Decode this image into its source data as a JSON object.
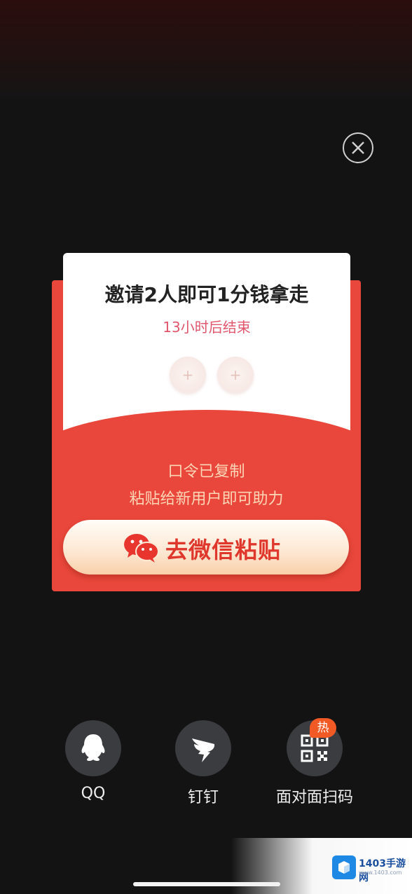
{
  "popup": {
    "title": "邀请2人即可1分钱拿走",
    "countdown": "13小时后结束",
    "slot_symbol": "+",
    "copied_text": "口令已复制",
    "paste_tip": "粘贴给新用户即可助力",
    "wechat_button": "去微信粘贴"
  },
  "share": {
    "items": [
      {
        "label": "QQ",
        "icon": "qq-icon"
      },
      {
        "label": "钉钉",
        "icon": "dingtalk-icon"
      },
      {
        "label": "面对面扫码",
        "icon": "qrcode-icon"
      }
    ],
    "hot_badge": "热"
  },
  "watermark": {
    "name": "1403手游网",
    "url": "www.1403.com"
  },
  "colors": {
    "card_red": "#e9473b",
    "countdown_pink": "#e0566c",
    "button_text": "#e0372c",
    "badge_orange": "#f15a24",
    "wechat_red": "#e8362e"
  }
}
